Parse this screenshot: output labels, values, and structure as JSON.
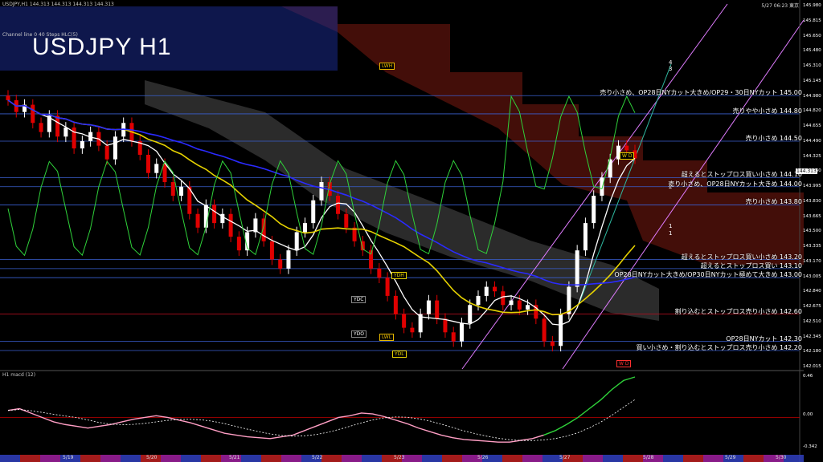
{
  "header": {
    "symbol_info": "USDJPY,H1  144.313 144.313 144.313 144.313",
    "indicator_info": "Channel line 0  40  Steps  HLC(5)",
    "big_title": "USDJPY H1",
    "datetime": "5/27  06:23  東京"
  },
  "macd_label": "H1  macd (12)",
  "price_axis": [
    "145.980",
    "145.815",
    "145.650",
    "145.480",
    "145.310",
    "145.145",
    "144.980",
    "144.820",
    "144.655",
    "144.490",
    "144.325",
    "144.160",
    "143.995",
    "143.830",
    "143.665",
    "143.500",
    "143.335",
    "143.170",
    "143.005",
    "142.840",
    "142.675",
    "142.510",
    "142.345",
    "142.180",
    "142.015"
  ],
  "macd_axis": [
    "0.46",
    "0.00",
    "-0.342"
  ],
  "date_axis": [
    "5/19",
    "5/20",
    "5/21",
    "5/22",
    "5/23",
    "5/26",
    "5/27",
    "5/28",
    "5/29",
    "5/30"
  ],
  "current_price": "144.313",
  "box_labels": {
    "lwh": "LWH",
    "ydh": "YDH",
    "ydc": "YDC",
    "ydo": "YDO",
    "lwl": "LWL",
    "ydl": "YDL",
    "wd_top": "W D",
    "wd_bottom": "W D"
  },
  "channel_numbers": [
    "4",
    "3",
    "2",
    "1",
    "1"
  ],
  "levels": [
    {
      "text": "売り小さめ、OP28日NYカット大きめ/OP29・30日NYカット 145.00",
      "price": 145.0,
      "color": "#ffffff"
    },
    {
      "text": "売りやや小さめ 144.80",
      "price": 144.8,
      "color": "#ffffff"
    },
    {
      "text": "売り小さめ 144.50",
      "price": 144.5,
      "color": "#ffffff"
    },
    {
      "text": "超えるとストップロス買い小さめ 144.10",
      "price": 144.1,
      "color": "#ffffff"
    },
    {
      "text": "売り小さめ、OP28日NYカット大きめ 144.00",
      "price": 144.0,
      "color": "#ffffff"
    },
    {
      "text": "売り小さめ 143.80",
      "price": 143.8,
      "color": "#ffffff"
    },
    {
      "text": "超えるとストップロス買い小さめ 143.20",
      "price": 143.2,
      "color": "#ffffff"
    },
    {
      "text": "超えるとストップロス買い 143.10",
      "price": 143.1,
      "color": "#ffffff"
    },
    {
      "text": "OP28日NYカット大きめ/OP30日NYカット極めて大きめ 143.00",
      "price": 143.0,
      "color": "#ffffff"
    },
    {
      "text": "割り込むとストップロス売り小さめ 142.60",
      "price": 142.6,
      "color": "#ffffff"
    },
    {
      "text": "OP28日NYカット 142.30",
      "price": 142.3,
      "color": "#ffffff"
    },
    {
      "text": "買い小さめ・割り込むとストップロス売り小さめ 142.20",
      "price": 142.2,
      "color": "#ffffff"
    }
  ],
  "colors": {
    "up": "#ffffff",
    "down": "#e00000",
    "ma_fast": "#ffffff",
    "ma_mid": "#e6d200",
    "ma_slow": "#2a2aff",
    "cloud": "#e8e8e8",
    "green": "#2fd23a",
    "channel": "#e07cff",
    "macd": "#ff9ec4",
    "signal": "#ffffff",
    "macd_up": "#2fd23a"
  },
  "chart_data": {
    "type": "candlestick",
    "title": "USDJPY H1",
    "ylim": [
      142.015,
      145.98
    ],
    "closes": [
      144.95,
      144.82,
      144.9,
      144.7,
      144.6,
      144.78,
      144.55,
      144.65,
      144.42,
      144.5,
      144.6,
      144.45,
      144.3,
      144.55,
      144.7,
      144.5,
      144.35,
      144.15,
      144.25,
      144.05,
      143.9,
      144.0,
      143.7,
      143.55,
      143.8,
      143.6,
      143.7,
      143.45,
      143.3,
      143.5,
      143.65,
      143.4,
      143.2,
      143.1,
      143.3,
      143.5,
      143.6,
      143.85,
      144.05,
      143.9,
      143.7,
      143.55,
      143.4,
      143.3,
      143.1,
      143.0,
      142.8,
      142.6,
      142.45,
      142.4,
      142.6,
      142.75,
      142.55,
      142.4,
      142.3,
      142.5,
      142.7,
      142.8,
      142.9,
      142.85,
      142.7,
      142.75,
      142.65,
      142.7,
      142.55,
      142.3,
      142.25,
      142.6,
      142.9,
      143.3,
      143.6,
      143.9,
      144.1,
      144.3,
      144.45,
      144.4,
      144.31
    ],
    "macd": [
      0.08,
      0.1,
      0.05,
      0.0,
      -0.05,
      -0.08,
      -0.1,
      -0.12,
      -0.1,
      -0.08,
      -0.05,
      -0.02,
      0.0,
      0.02,
      0.0,
      -0.03,
      -0.06,
      -0.1,
      -0.14,
      -0.18,
      -0.2,
      -0.22,
      -0.23,
      -0.24,
      -0.22,
      -0.2,
      -0.15,
      -0.1,
      -0.05,
      0.0,
      0.02,
      0.05,
      0.04,
      0.01,
      -0.03,
      -0.07,
      -0.12,
      -0.16,
      -0.2,
      -0.23,
      -0.25,
      -0.26,
      -0.27,
      -0.28,
      -0.28,
      -0.26,
      -0.24,
      -0.2,
      -0.15,
      -0.08,
      0.0,
      0.1,
      0.2,
      0.32,
      0.42,
      0.46
    ]
  }
}
